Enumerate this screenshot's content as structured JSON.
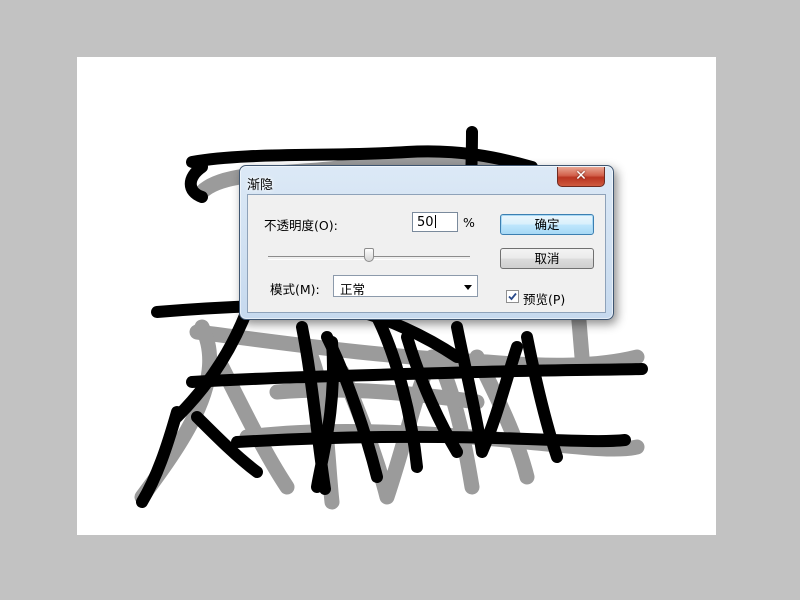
{
  "dialog": {
    "title": "渐隐",
    "close_symbol": "✕",
    "opacity_label": "不透明度(O):",
    "opacity_value": "50",
    "opacity_unit": "%",
    "opacity_slider_percent": 50,
    "mode_label": "模式(M):",
    "mode_value": "正常",
    "ok_label": "确定",
    "cancel_label": "取消",
    "preview_label": "预览(P)",
    "preview_checked": true
  },
  "icons": {
    "close": "close-icon",
    "dropdown": "chevron-down-icon",
    "check": "check-icon"
  },
  "colors": {
    "stroke": "#000000",
    "faded_stroke": "#9a9a9a",
    "workspace": "#c2c2c2",
    "close_button": "#c7472f",
    "default_button": "#bee6fd"
  }
}
